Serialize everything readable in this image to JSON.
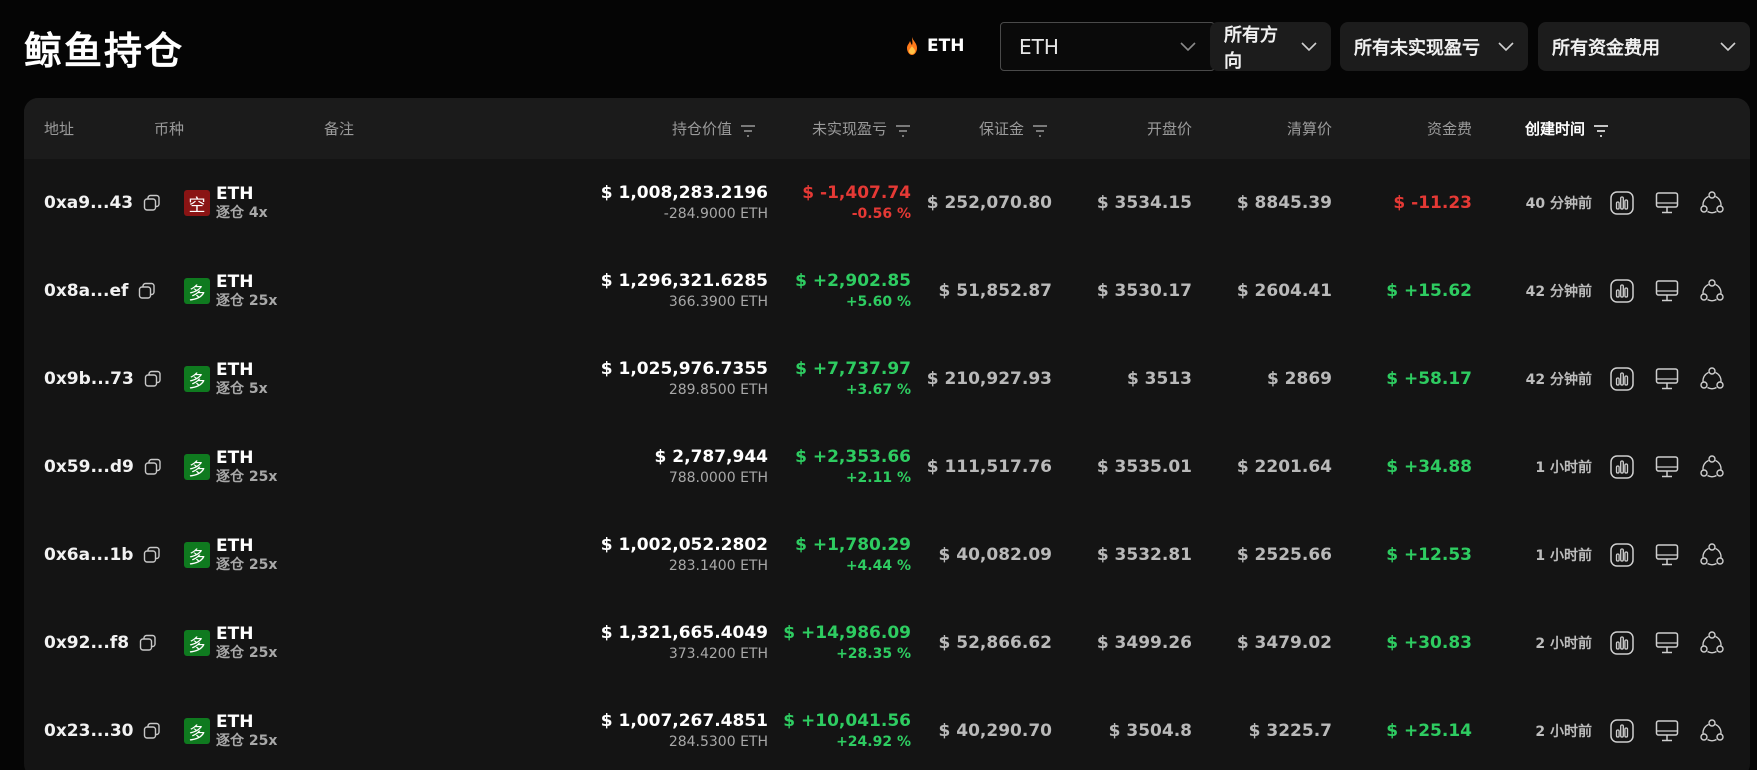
{
  "header": {
    "title": "鲸鱼持仓",
    "coin_tag": "ETH",
    "coin_select_value": "ETH",
    "filters": [
      "所有方向",
      "所有未实现盈亏",
      "所有资金费用"
    ]
  },
  "colors": {
    "positive": "#2ecc61",
    "negative": "#e53935",
    "short_badge": "#8a1414",
    "long_badge": "#0f7a1f"
  },
  "table": {
    "columns": {
      "address": "地址",
      "coin": "币种",
      "note": "备注",
      "position_value": "持仓价值",
      "unrealized_pnl": "未实现盈亏",
      "margin": "保证金",
      "open_price": "开盘价",
      "liq_price": "清算价",
      "funding": "资金费",
      "created": "创建时间"
    },
    "rows": [
      {
        "address": "0xa9...43",
        "side": "空",
        "side_type": "short",
        "coin": "ETH",
        "leverage": "逐仓 4x",
        "value": "$ 1,008,283.2196",
        "size": "-284.9000 ETH",
        "pnl": "$ -1,407.74",
        "pnl_pct": "-0.56 %",
        "pnl_sign": "neg",
        "margin": "$ 252,070.80",
        "open": "$ 3534.15",
        "liq": "$ 8845.39",
        "funding": "$ -11.23",
        "funding_sign": "neg",
        "time": "40 分钟前"
      },
      {
        "address": "0x8a...ef",
        "side": "多",
        "side_type": "long",
        "coin": "ETH",
        "leverage": "逐仓 25x",
        "value": "$ 1,296,321.6285",
        "size": "366.3900 ETH",
        "pnl": "$ +2,902.85",
        "pnl_pct": "+5.60 %",
        "pnl_sign": "pos",
        "margin": "$ 51,852.87",
        "open": "$ 3530.17",
        "liq": "$ 2604.41",
        "funding": "$ +15.62",
        "funding_sign": "pos",
        "time": "42 分钟前"
      },
      {
        "address": "0x9b...73",
        "side": "多",
        "side_type": "long",
        "coin": "ETH",
        "leverage": "逐仓 5x",
        "value": "$ 1,025,976.7355",
        "size": "289.8500 ETH",
        "pnl": "$ +7,737.97",
        "pnl_pct": "+3.67 %",
        "pnl_sign": "pos",
        "margin": "$ 210,927.93",
        "open": "$ 3513",
        "liq": "$ 2869",
        "funding": "$ +58.17",
        "funding_sign": "pos",
        "time": "42 分钟前"
      },
      {
        "address": "0x59...d9",
        "side": "多",
        "side_type": "long",
        "coin": "ETH",
        "leverage": "逐仓 25x",
        "value": "$ 2,787,944",
        "size": "788.0000 ETH",
        "pnl": "$ +2,353.66",
        "pnl_pct": "+2.11 %",
        "pnl_sign": "pos",
        "margin": "$ 111,517.76",
        "open": "$ 3535.01",
        "liq": "$ 2201.64",
        "funding": "$ +34.88",
        "funding_sign": "pos",
        "time": "1 小时前"
      },
      {
        "address": "0x6a...1b",
        "side": "多",
        "side_type": "long",
        "coin": "ETH",
        "leverage": "逐仓 25x",
        "value": "$ 1,002,052.2802",
        "size": "283.1400 ETH",
        "pnl": "$ +1,780.29",
        "pnl_pct": "+4.44 %",
        "pnl_sign": "pos",
        "margin": "$ 40,082.09",
        "open": "$ 3532.81",
        "liq": "$ 2525.66",
        "funding": "$ +12.53",
        "funding_sign": "pos",
        "time": "1 小时前"
      },
      {
        "address": "0x92...f8",
        "side": "多",
        "side_type": "long",
        "coin": "ETH",
        "leverage": "逐仓 25x",
        "value": "$ 1,321,665.4049",
        "size": "373.4200 ETH",
        "pnl": "$ +14,986.09",
        "pnl_pct": "+28.35 %",
        "pnl_sign": "pos",
        "margin": "$ 52,866.62",
        "open": "$ 3499.26",
        "liq": "$ 3479.02",
        "funding": "$ +30.83",
        "funding_sign": "pos",
        "time": "2 小时前"
      },
      {
        "address": "0x23...30",
        "side": "多",
        "side_type": "long",
        "coin": "ETH",
        "leverage": "逐仓 25x",
        "value": "$ 1,007,267.4851",
        "size": "284.5300 ETH",
        "pnl": "$ +10,041.56",
        "pnl_pct": "+24.92 %",
        "pnl_sign": "pos",
        "margin": "$ 40,290.70",
        "open": "$ 3504.8",
        "liq": "$ 3225.7",
        "funding": "$ +25.14",
        "funding_sign": "pos",
        "time": "2 小时前"
      }
    ]
  },
  "icons": {
    "copy": "copy-icon",
    "chart": "chart-icon",
    "monitor": "monitor-icon",
    "share": "share-icon",
    "filter": "filter-icon",
    "chevron": "chevron-down-icon",
    "fire": "fire-icon"
  }
}
